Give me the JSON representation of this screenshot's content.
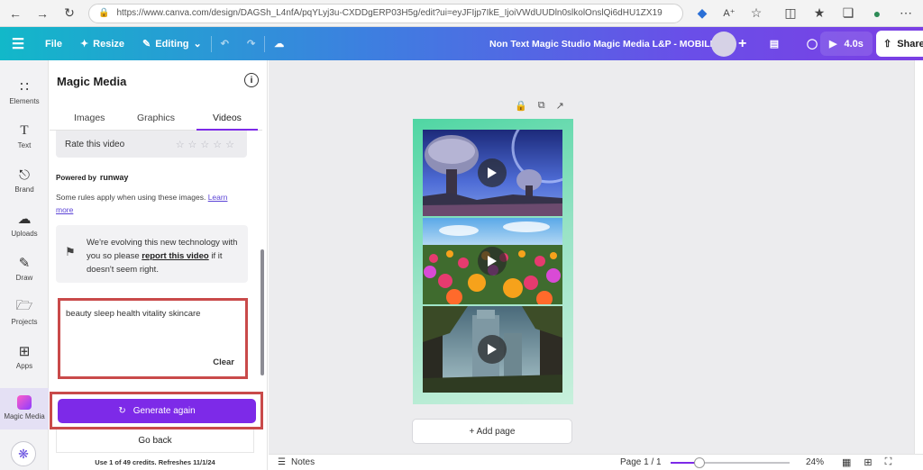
{
  "browser": {
    "url": "https://www.canva.com/design/DAGSh_L4nfA/pqYLyj3u-CXDDgERP03H5g/edit?ui=eyJFIjp7IkE_IjoiVWdUUDln0slkolOnslQi6dHU1ZX19",
    "icons": [
      "back-icon",
      "forward-icon",
      "refresh-icon",
      "lock-icon",
      "extension-icon",
      "font-icon",
      "star-icon",
      "sidebar-icon",
      "favorites-icon",
      "collections-icon",
      "extensions-icon"
    ]
  },
  "header": {
    "file_label": "File",
    "resize_label": "Resize",
    "editing_label": "Editing",
    "document_title": "Non Text Magic Studio Magic Media L&P - MOBILE",
    "play_duration": "4.0s",
    "share_label": "Share",
    "colors": {
      "gradient_start": "#12b8c9",
      "gradient_end": "#7b3fe4"
    }
  },
  "rail": {
    "items": [
      {
        "label": "Elements",
        "icon": "elements-icon"
      },
      {
        "label": "Text",
        "icon": "text-icon"
      },
      {
        "label": "Brand",
        "icon": "brand-icon"
      },
      {
        "label": "Uploads",
        "icon": "upload-icon"
      },
      {
        "label": "Draw",
        "icon": "draw-icon"
      },
      {
        "label": "Projects",
        "icon": "folder-icon"
      },
      {
        "label": "Apps",
        "icon": "apps-icon"
      },
      {
        "label": "Magic Media",
        "icon": "magic-media-icon"
      }
    ],
    "active": "Magic Media"
  },
  "panel": {
    "title": "Magic Media",
    "tabs": [
      {
        "label": "Images"
      },
      {
        "label": "Graphics"
      },
      {
        "label": "Videos"
      }
    ],
    "active_tab": "Videos",
    "rate_label": "Rate this video",
    "rating": "0 of 5 stars",
    "powered_by": "Powered by",
    "powered_brand": "runway",
    "rules_text": "Some rules apply when using these images.",
    "learn_more": "Learn more",
    "notice_text_1": "We're evolving this new technology with you so please",
    "notice_link": "report this video",
    "notice_text_2": "if it doesn't seem right.",
    "prompt_value": "beauty sleep health vitality skincare",
    "clear_label": "Clear",
    "generate_label": "Generate again",
    "go_back_label": "Go back",
    "credits_text": "Use 1 of 49 credits. Refreshes 11/1/24",
    "accent_color": "#7d2ae8",
    "highlight_color": "#c94a4a"
  },
  "canvas": {
    "add_page_label": "+ Add page",
    "videos": [
      {
        "name": "alien-landscape-video"
      },
      {
        "name": "flower-field-video"
      },
      {
        "name": "forest-city-video"
      }
    ]
  },
  "footer": {
    "notes_label": "Notes",
    "page_indicator": "Page 1 / 1",
    "zoom_level": "24%",
    "zoom_fraction": 0.24
  }
}
